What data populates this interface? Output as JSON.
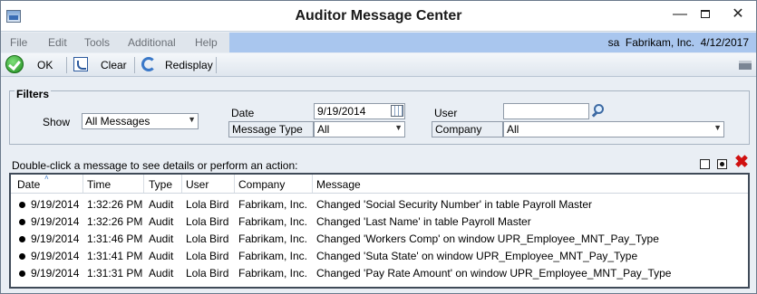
{
  "window": {
    "title": "Auditor Message Center",
    "min": "—",
    "close": "✕"
  },
  "menu": [
    "File",
    "Edit",
    "Tools",
    "Additional",
    "Help"
  ],
  "userbar": "sa  Fabrikam, Inc.  4/12/2017",
  "toolbar": {
    "ok": "OK",
    "clear": "Clear",
    "redisplay": "Redisplay",
    "icons": [
      "check-circle-icon",
      "clear-icon",
      "redisplay-icon",
      "printer-icon"
    ]
  },
  "filters": {
    "title": "Filters",
    "show_label": "Show",
    "show_value": "All Messages",
    "date_label": "Date",
    "date_value": "9/19/2014",
    "message_type_label": "Message Type",
    "message_type_value": "All",
    "user_label": "User",
    "user_value": "",
    "company_label": "Company",
    "company_value": "All"
  },
  "instruction": "Double-click a message to see details or perform an action:",
  "table": {
    "columns": [
      "Date",
      "Time",
      "Type",
      "User",
      "Company",
      "Message"
    ],
    "sort_indicator": "˄",
    "rows": [
      {
        "date": "9/19/2014",
        "time": "1:32:26 PM",
        "type": "Audit",
        "user": "Lola Bird",
        "company": "Fabrikam, Inc.",
        "message": "Changed 'Social Security Number' in table Payroll Master"
      },
      {
        "date": "9/19/2014",
        "time": "1:32:26 PM",
        "type": "Audit",
        "user": "Lola Bird",
        "company": "Fabrikam, Inc.",
        "message": "Changed 'Last Name' in table Payroll Master"
      },
      {
        "date": "9/19/2014",
        "time": "1:31:46 PM",
        "type": "Audit",
        "user": "Lola Bird",
        "company": "Fabrikam, Inc.",
        "message": "Changed 'Workers Comp' on window UPR_Employee_MNT_Pay_Type"
      },
      {
        "date": "9/19/2014",
        "time": "1:31:41 PM",
        "type": "Audit",
        "user": "Lola Bird",
        "company": "Fabrikam, Inc.",
        "message": "Changed 'Suta State' on window UPR_Employee_MNT_Pay_Type"
      },
      {
        "date": "9/19/2014",
        "time": "1:31:31 PM",
        "type": "Audit",
        "user": "Lola Bird",
        "company": "Fabrikam, Inc.",
        "message": "Changed 'Pay Rate Amount' on window UPR_Employee_MNT_Pay_Type"
      }
    ]
  },
  "colors": {
    "userbar": "#a9c6ee",
    "ok_icon": "#1d8b1d",
    "delete_icon": "#d01010"
  }
}
